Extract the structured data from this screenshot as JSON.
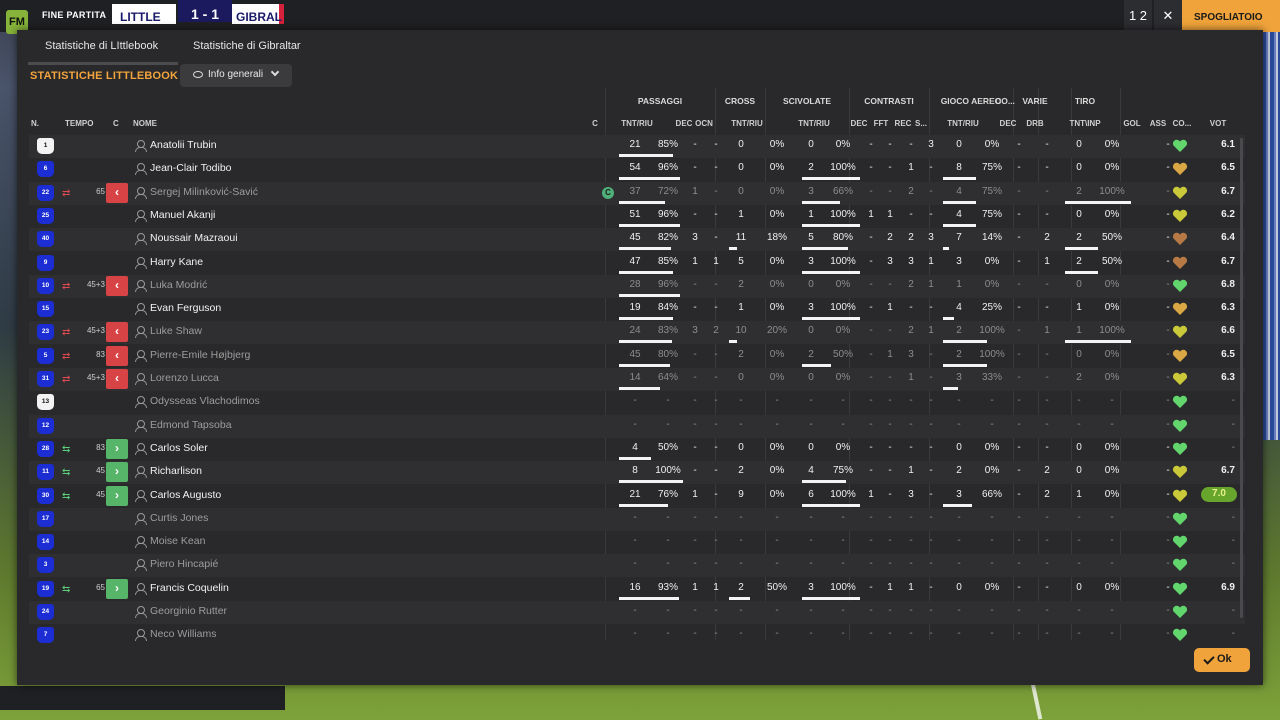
{
  "topbar": {
    "final_label": "FINE PARTITA",
    "team_home": "LITTLE",
    "score": "1 - 1",
    "team_away": "GIBRAL",
    "btn1": "1 2",
    "close_icon": "close-icon",
    "action_label": "SPOGLIATOIO"
  },
  "tabs": [
    "Statistiche di LIttlebook",
    "Statistiche di Gibraltar"
  ],
  "section_title": "STATISTICHE LITTLEBOOK",
  "dropdown_label": "Info generali",
  "groups": {
    "passaggi": "PASSAGGI",
    "cross": "CROSS",
    "scivolate": "SCIVOLATE",
    "contrasti": "CONTRASTI",
    "gioco_aereo": "GIOCO AEREO",
    "co": "CO...",
    "varie": "VARIE",
    "tiro": "TIRO"
  },
  "headers": {
    "n": "N.",
    "tempo": "TEMPO",
    "c": "C",
    "nome": "NOME",
    "c2": "C",
    "pass_tnt": "TNT/RIU",
    "pass_dec": "DEC",
    "pass_ocn": "OCN",
    "cross_tnt": "TNT/RIU",
    "sciv_tnt": "TNT/RIU",
    "con_dec": "DEC",
    "con_fft": "FFT",
    "con_rec": "REC",
    "con_s": "S...",
    "aer_tnt": "TNT/RIU",
    "co_dec": "DEC",
    "var_drb": "DRB",
    "tiro_tnt": "TNT\\INP",
    "gol": "GOL",
    "ass": "ASS",
    "co2": "CO...",
    "vot": "VOT"
  },
  "players": [
    {
      "num": "1",
      "gk": true,
      "sub": "",
      "min": "",
      "name": "Anatolii Trubin",
      "dim": false,
      "cap": false,
      "p1": "21",
      "p2": "85%",
      "pdec": "-",
      "pocn": "-",
      "c1": "0",
      "c2": "0%",
      "s1": "0",
      "s2": "0%",
      "cdec": "-",
      "cfft": "-",
      "crec": "-",
      "cs": "3",
      "a1": "0",
      "a2": "0%",
      "codec": "-",
      "drb": "-",
      "t1": "0",
      "t2": "0%",
      "gol": "",
      "ass": "-",
      "rating": "6.1",
      "pb": 0.85,
      "cb": 0,
      "sb": 0,
      "ab": 0,
      "tb": 0,
      "mood": "#62d66d"
    },
    {
      "num": "6",
      "gk": false,
      "sub": "",
      "min": "",
      "name": "Jean-Clair Todibo",
      "dim": false,
      "cap": false,
      "p1": "54",
      "p2": "96%",
      "pdec": "-",
      "pocn": "-",
      "c1": "0",
      "c2": "0%",
      "s1": "2",
      "s2": "100%",
      "cdec": "-",
      "cfft": "-",
      "crec": "1",
      "cs": "-",
      "a1": "8",
      "a2": "75%",
      "codec": "-",
      "drb": "-",
      "t1": "0",
      "t2": "0%",
      "gol": "",
      "ass": "-",
      "rating": "6.5",
      "pb": 0.96,
      "cb": 0,
      "sb": 1,
      "ab": 0.75,
      "tb": 0,
      "mood": "#d9a844"
    },
    {
      "num": "22",
      "gk": false,
      "sub": "out",
      "min": "65",
      "name": "Sergej Milinković-Savić",
      "dim": true,
      "cap": true,
      "p1": "37",
      "p2": "72%",
      "pdec": "1",
      "pocn": "-",
      "c1": "0",
      "c2": "0%",
      "s1": "3",
      "s2": "66%",
      "cdec": "-",
      "cfft": "-",
      "crec": "2",
      "cs": "-",
      "a1": "4",
      "a2": "75%",
      "codec": "-",
      "drb": "-",
      "t1": "2",
      "t2": "100%",
      "gol": "",
      "ass": "-",
      "rating": "6.7",
      "pb": 0.72,
      "cb": 0,
      "sb": 0.66,
      "ab": 0.75,
      "tb": 1,
      "mood": "#c9c93a"
    },
    {
      "num": "25",
      "gk": false,
      "sub": "",
      "min": "",
      "name": "Manuel Akanji",
      "dim": false,
      "cap": false,
      "p1": "51",
      "p2": "96%",
      "pdec": "-",
      "pocn": "-",
      "c1": "1",
      "c2": "0%",
      "s1": "1",
      "s2": "100%",
      "cdec": "1",
      "cfft": "1",
      "crec": "-",
      "cs": "-",
      "a1": "4",
      "a2": "75%",
      "codec": "-",
      "drb": "-",
      "t1": "0",
      "t2": "0%",
      "gol": "",
      "ass": "-",
      "rating": "6.2",
      "pb": 0.96,
      "cb": 0,
      "sb": 1,
      "ab": 0.75,
      "tb": 0,
      "mood": "#c9c93a"
    },
    {
      "num": "40",
      "gk": false,
      "sub": "",
      "min": "",
      "name": "Noussair Mazraoui",
      "dim": false,
      "cap": false,
      "p1": "45",
      "p2": "82%",
      "pdec": "3",
      "pocn": "-",
      "c1": "11",
      "c2": "18%",
      "s1": "5",
      "s2": "80%",
      "cdec": "-",
      "cfft": "2",
      "crec": "2",
      "cs": "3",
      "a1": "7",
      "a2": "14%",
      "codec": "-",
      "drb": "2",
      "t1": "2",
      "t2": "50%",
      "gol": "",
      "ass": "-",
      "rating": "6.4",
      "pb": 0.82,
      "cb": 0.18,
      "sb": 0.8,
      "ab": 0.14,
      "tb": 0.5,
      "mood": "#b77a45"
    },
    {
      "num": "9",
      "gk": false,
      "sub": "",
      "min": "",
      "name": "Harry Kane",
      "dim": false,
      "cap": false,
      "p1": "47",
      "p2": "85%",
      "pdec": "1",
      "pocn": "1",
      "c1": "5",
      "c2": "0%",
      "s1": "3",
      "s2": "100%",
      "cdec": "-",
      "cfft": "3",
      "crec": "3",
      "cs": "1",
      "a1": "3",
      "a2": "0%",
      "codec": "-",
      "drb": "1",
      "t1": "2",
      "t2": "50%",
      "gol": "",
      "ass": "-",
      "rating": "6.7",
      "pb": 0.85,
      "cb": 0,
      "sb": 1,
      "ab": 0,
      "tb": 0.5,
      "mood": "#b77a45"
    },
    {
      "num": "10",
      "gk": false,
      "sub": "out",
      "min": "45+3",
      "name": "Luka Modrić",
      "dim": true,
      "cap": false,
      "p1": "28",
      "p2": "96%",
      "pdec": "-",
      "pocn": "-",
      "c1": "2",
      "c2": "0%",
      "s1": "0",
      "s2": "0%",
      "cdec": "-",
      "cfft": "-",
      "crec": "2",
      "cs": "1",
      "a1": "1",
      "a2": "0%",
      "codec": "-",
      "drb": "-",
      "t1": "0",
      "t2": "0%",
      "gol": "",
      "ass": "-",
      "rating": "6.8",
      "pb": 0.96,
      "cb": 0,
      "sb": 0,
      "ab": 0,
      "tb": 0,
      "mood": "#62d66d"
    },
    {
      "num": "15",
      "gk": false,
      "sub": "",
      "min": "",
      "name": "Evan Ferguson",
      "dim": false,
      "cap": false,
      "p1": "19",
      "p2": "84%",
      "pdec": "-",
      "pocn": "-",
      "c1": "1",
      "c2": "0%",
      "s1": "3",
      "s2": "100%",
      "cdec": "-",
      "cfft": "1",
      "crec": "-",
      "cs": "-",
      "a1": "4",
      "a2": "25%",
      "codec": "-",
      "drb": "-",
      "t1": "1",
      "t2": "0%",
      "gol": "",
      "ass": "-",
      "rating": "6.3",
      "pb": 0.84,
      "cb": 0,
      "sb": 1,
      "ab": 0.25,
      "tb": 0,
      "mood": "#d9a844"
    },
    {
      "num": "23",
      "gk": false,
      "sub": "out",
      "min": "45+3",
      "name": "Luke Shaw",
      "dim": true,
      "cap": false,
      "p1": "24",
      "p2": "83%",
      "pdec": "3",
      "pocn": "2",
      "c1": "10",
      "c2": "20%",
      "s1": "0",
      "s2": "0%",
      "cdec": "-",
      "cfft": "-",
      "crec": "2",
      "cs": "1",
      "a1": "2",
      "a2": "100%",
      "codec": "-",
      "drb": "1",
      "t1": "1",
      "t2": "100%",
      "gol": "",
      "ass": "-",
      "rating": "6.6",
      "pb": 0.83,
      "cb": 0.2,
      "sb": 0,
      "ab": 1,
      "tb": 1,
      "mood": "#c9c93a"
    },
    {
      "num": "5",
      "gk": false,
      "sub": "out",
      "min": "83",
      "name": "Pierre-Emile Højbjerg",
      "dim": true,
      "cap": false,
      "p1": "45",
      "p2": "80%",
      "pdec": "-",
      "pocn": "-",
      "c1": "2",
      "c2": "0%",
      "s1": "2",
      "s2": "50%",
      "cdec": "-",
      "cfft": "1",
      "crec": "3",
      "cs": "-",
      "a1": "2",
      "a2": "100%",
      "codec": "-",
      "drb": "-",
      "t1": "0",
      "t2": "0%",
      "gol": "",
      "ass": "-",
      "rating": "6.5",
      "pb": 0.8,
      "cb": 0,
      "sb": 0.5,
      "ab": 1,
      "tb": 0,
      "mood": "#d9a844"
    },
    {
      "num": "31",
      "gk": false,
      "sub": "out",
      "min": "45+3",
      "name": "Lorenzo Lucca",
      "dim": true,
      "cap": false,
      "p1": "14",
      "p2": "64%",
      "pdec": "-",
      "pocn": "-",
      "c1": "0",
      "c2": "0%",
      "s1": "0",
      "s2": "0%",
      "cdec": "-",
      "cfft": "-",
      "crec": "1",
      "cs": "-",
      "a1": "3",
      "a2": "33%",
      "codec": "-",
      "drb": "-",
      "t1": "2",
      "t2": "0%",
      "gol": "",
      "ass": "-",
      "rating": "6.3",
      "pb": 0.64,
      "cb": 0,
      "sb": 0,
      "ab": 0.33,
      "tb": 0,
      "mood": "#c9c93a"
    },
    {
      "num": "13",
      "gk": true,
      "sub": "",
      "min": "",
      "name": "Odysseas Vlachodimos",
      "dim": true,
      "cap": false,
      "p1": "-",
      "p2": "-",
      "pdec": "-",
      "pocn": "-",
      "c1": "-",
      "c2": "-",
      "s1": "-",
      "s2": "-",
      "cdec": "-",
      "cfft": "-",
      "crec": "-",
      "cs": "-",
      "a1": "-",
      "a2": "-",
      "codec": "-",
      "drb": "-",
      "t1": "-",
      "t2": "-",
      "gol": "",
      "ass": "-",
      "rating": "-",
      "pb": 0,
      "cb": 0,
      "sb": 0,
      "ab": 0,
      "tb": 0,
      "mood": "#62d66d"
    },
    {
      "num": "12",
      "gk": false,
      "sub": "",
      "min": "",
      "name": "Edmond Tapsoba",
      "dim": true,
      "cap": false,
      "p1": "-",
      "p2": "-",
      "pdec": "-",
      "pocn": "-",
      "c1": "-",
      "c2": "-",
      "s1": "-",
      "s2": "-",
      "cdec": "-",
      "cfft": "-",
      "crec": "-",
      "cs": "-",
      "a1": "-",
      "a2": "-",
      "codec": "-",
      "drb": "-",
      "t1": "-",
      "t2": "-",
      "gol": "",
      "ass": "-",
      "rating": "-",
      "pb": 0,
      "cb": 0,
      "sb": 0,
      "ab": 0,
      "tb": 0,
      "mood": "#62d66d"
    },
    {
      "num": "28",
      "gk": false,
      "sub": "in",
      "min": "83",
      "name": "Carlos Soler",
      "dim": false,
      "cap": false,
      "p1": "4",
      "p2": "50%",
      "pdec": "-",
      "pocn": "-",
      "c1": "0",
      "c2": "0%",
      "s1": "0",
      "s2": "0%",
      "cdec": "-",
      "cfft": "-",
      "crec": "-",
      "cs": "-",
      "a1": "0",
      "a2": "0%",
      "codec": "-",
      "drb": "-",
      "t1": "0",
      "t2": "0%",
      "gol": "",
      "ass": "-",
      "rating": "-",
      "pb": 0.5,
      "cb": 0,
      "sb": 0,
      "ab": 0,
      "tb": 0,
      "mood": "#62d66d"
    },
    {
      "num": "11",
      "gk": false,
      "sub": "in",
      "min": "45",
      "name": "Richarlison",
      "dim": false,
      "cap": false,
      "p1": "8",
      "p2": "100%",
      "pdec": "-",
      "pocn": "-",
      "c1": "2",
      "c2": "0%",
      "s1": "4",
      "s2": "75%",
      "cdec": "-",
      "cfft": "-",
      "crec": "1",
      "cs": "-",
      "a1": "2",
      "a2": "0%",
      "codec": "-",
      "drb": "2",
      "t1": "0",
      "t2": "0%",
      "gol": "",
      "ass": "-",
      "rating": "6.7",
      "pb": 1,
      "cb": 0,
      "sb": 0.75,
      "ab": 0,
      "tb": 0,
      "mood": "#c9c93a"
    },
    {
      "num": "30",
      "gk": false,
      "sub": "in",
      "min": "45",
      "name": "Carlos Augusto",
      "dim": false,
      "cap": false,
      "p1": "21",
      "p2": "76%",
      "pdec": "1",
      "pocn": "-",
      "c1": "9",
      "c2": "0%",
      "s1": "6",
      "s2": "100%",
      "cdec": "1",
      "cfft": "-",
      "crec": "3",
      "cs": "-",
      "a1": "3",
      "a2": "66%",
      "codec": "-",
      "drb": "2",
      "t1": "1",
      "t2": "0%",
      "gol": "",
      "ass": "-",
      "rating": "7.0",
      "highlight": true,
      "pb": 0.76,
      "cb": 0,
      "sb": 1,
      "ab": 0.66,
      "tb": 0,
      "mood": "#c9c93a"
    },
    {
      "num": "17",
      "gk": false,
      "sub": "",
      "min": "",
      "name": "Curtis Jones",
      "dim": true,
      "cap": false,
      "p1": "-",
      "p2": "-",
      "pdec": "-",
      "pocn": "-",
      "c1": "-",
      "c2": "-",
      "s1": "-",
      "s2": "-",
      "cdec": "-",
      "cfft": "-",
      "crec": "-",
      "cs": "-",
      "a1": "-",
      "a2": "-",
      "codec": "-",
      "drb": "-",
      "t1": "-",
      "t2": "-",
      "gol": "",
      "ass": "-",
      "rating": "-",
      "pb": 0,
      "cb": 0,
      "sb": 0,
      "ab": 0,
      "tb": 0,
      "mood": "#62d66d"
    },
    {
      "num": "14",
      "gk": false,
      "sub": "",
      "min": "",
      "name": "Moise Kean",
      "dim": true,
      "cap": false,
      "p1": "-",
      "p2": "-",
      "pdec": "-",
      "pocn": "-",
      "c1": "-",
      "c2": "-",
      "s1": "-",
      "s2": "-",
      "cdec": "-",
      "cfft": "-",
      "crec": "-",
      "cs": "-",
      "a1": "-",
      "a2": "-",
      "codec": "-",
      "drb": "-",
      "t1": "-",
      "t2": "-",
      "gol": "",
      "ass": "-",
      "rating": "-",
      "pb": 0,
      "cb": 0,
      "sb": 0,
      "ab": 0,
      "tb": 0,
      "mood": "#62d66d"
    },
    {
      "num": "3",
      "gk": false,
      "sub": "",
      "min": "",
      "name": "Piero Hincapié",
      "dim": true,
      "cap": false,
      "p1": "-",
      "p2": "-",
      "pdec": "-",
      "pocn": "-",
      "c1": "-",
      "c2": "-",
      "s1": "-",
      "s2": "-",
      "cdec": "-",
      "cfft": "-",
      "crec": "-",
      "cs": "-",
      "a1": "-",
      "a2": "-",
      "codec": "-",
      "drb": "-",
      "t1": "-",
      "t2": "-",
      "gol": "",
      "ass": "-",
      "rating": "-",
      "pb": 0,
      "cb": 0,
      "sb": 0,
      "ab": 0,
      "tb": 0,
      "mood": "#62d66d"
    },
    {
      "num": "19",
      "gk": false,
      "sub": "in",
      "min": "65",
      "name": "Francis Coquelin",
      "dim": false,
      "cap": false,
      "p1": "16",
      "p2": "93%",
      "pdec": "1",
      "pocn": "1",
      "c1": "2",
      "c2": "50%",
      "s1": "3",
      "s2": "100%",
      "cdec": "-",
      "cfft": "1",
      "crec": "1",
      "cs": "-",
      "a1": "0",
      "a2": "0%",
      "codec": "-",
      "drb": "-",
      "t1": "0",
      "t2": "0%",
      "gol": "",
      "ass": "-",
      "rating": "6.9",
      "pb": 0.93,
      "cb": 0.5,
      "sb": 1,
      "ab": 0,
      "tb": 0,
      "mood": "#62d66d"
    },
    {
      "num": "24",
      "gk": false,
      "sub": "",
      "min": "",
      "name": "Georginio Rutter",
      "dim": true,
      "cap": false,
      "p1": "-",
      "p2": "-",
      "pdec": "-",
      "pocn": "-",
      "c1": "-",
      "c2": "-",
      "s1": "-",
      "s2": "-",
      "cdec": "-",
      "cfft": "-",
      "crec": "-",
      "cs": "-",
      "a1": "-",
      "a2": "-",
      "codec": "-",
      "drb": "-",
      "t1": "-",
      "t2": "-",
      "gol": "",
      "ass": "-",
      "rating": "-",
      "pb": 0,
      "cb": 0,
      "sb": 0,
      "ab": 0,
      "tb": 0,
      "mood": "#62d66d"
    },
    {
      "num": "7",
      "gk": false,
      "sub": "",
      "min": "",
      "name": "Neco Williams",
      "dim": true,
      "cap": false,
      "p1": "-",
      "p2": "-",
      "pdec": "-",
      "pocn": "-",
      "c1": "-",
      "c2": "-",
      "s1": "-",
      "s2": "-",
      "cdec": "-",
      "cfft": "-",
      "crec": "-",
      "cs": "-",
      "a1": "-",
      "a2": "-",
      "codec": "-",
      "drb": "-",
      "t1": "-",
      "t2": "-",
      "gol": "",
      "ass": "-",
      "rating": "-",
      "pb": 0,
      "cb": 0,
      "sb": 0,
      "ab": 0,
      "tb": 0,
      "mood": "#62d66d"
    }
  ],
  "ok_label": "Ok",
  "colors": {
    "accent": "#f0a33a",
    "out": "#d84446",
    "in": "#57b56a",
    "shirt": "#1b2dd3"
  }
}
